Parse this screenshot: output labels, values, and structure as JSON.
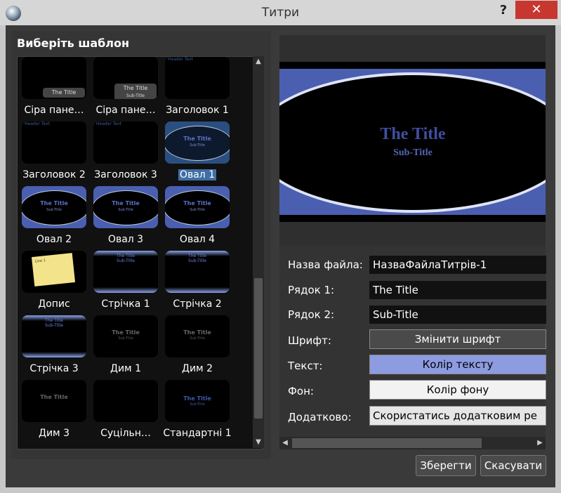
{
  "window": {
    "title": "Титри",
    "help": "?",
    "close": "✕"
  },
  "left": {
    "heading": "Виберіть шаблон"
  },
  "templates": [
    {
      "label": "Сіра пане…",
      "style": "panel",
      "thumb_text": "The Title"
    },
    {
      "label": "Сіра пане…",
      "style": "panel2",
      "thumb_text": "The Title",
      "thumb_sub": "Sub-Title"
    },
    {
      "label": "Заголовок 1",
      "style": "header",
      "thumb_text": "Header Text"
    },
    {
      "label": "Заголовок 2",
      "style": "header",
      "thumb_text": "Header Text"
    },
    {
      "label": "Заголовок 3",
      "style": "header",
      "thumb_text": "Header Text"
    },
    {
      "label": "Овал 1",
      "style": "oval-sel",
      "thumb_text": "The Title",
      "thumb_sub": "Sub-Title",
      "selected": true
    },
    {
      "label": "Овал 2",
      "style": "oval",
      "thumb_text": "The Title",
      "thumb_sub": "Sub-Title"
    },
    {
      "label": "Овал 3",
      "style": "oval",
      "thumb_text": "The Title",
      "thumb_sub": "Sub-Title"
    },
    {
      "label": "Овал 4",
      "style": "oval",
      "thumb_text": "The Title",
      "thumb_sub": "Sub-Title"
    },
    {
      "label": "Допис",
      "style": "note",
      "thumb_text": "Line 1"
    },
    {
      "label": "Стрічка 1",
      "style": "ribbon",
      "thumb_text": "The Title",
      "thumb_sub": "Sub-Title"
    },
    {
      "label": "Стрічка 2",
      "style": "ribbon",
      "thumb_text": "The Title",
      "thumb_sub": "Sub-Title"
    },
    {
      "label": "Стрічка 3",
      "style": "ribbon3",
      "thumb_text": "The Title",
      "thumb_sub": "Sub-Title"
    },
    {
      "label": "Дим 1",
      "style": "smoke",
      "thumb_text": "The Title",
      "thumb_sub": "Sub-Title"
    },
    {
      "label": "Дим 2",
      "style": "smoke",
      "thumb_text": "The Title",
      "thumb_sub": "Sub-Title"
    },
    {
      "label": "Дим 3",
      "style": "smoke",
      "thumb_text": "The Title"
    },
    {
      "label": "Суцільн…",
      "style": "plain",
      "thumb_text": ""
    },
    {
      "label": "Стандартні 1",
      "style": "std",
      "thumb_text": "The Title",
      "thumb_sub": "Sub-Title"
    }
  ],
  "preview": {
    "title": "The Title",
    "subtitle": "Sub-Title"
  },
  "props": {
    "filename_label": "Назва файла:",
    "filename_value": "НазваФайлаТитрів-1",
    "line1_label": "Рядок 1:",
    "line1_value": "The Title",
    "line2_label": "Рядок 2:",
    "line2_value": "Sub-Title",
    "font_label": "Шрифт:",
    "font_button": "Змінити шрифт",
    "text_label": "Текст:",
    "text_button": "Колір тексту",
    "bg_label": "Фон:",
    "bg_button": "Колір фону",
    "advanced_label": "Додатково:",
    "advanced_button": "Скористатись додатковим ре"
  },
  "buttons": {
    "save": "Зберегти",
    "cancel": "Скасувати"
  },
  "colors": {
    "accent": "#3f6fa5",
    "oval_blue": "#4a5fb0",
    "text_color_btn": "#8d9be0",
    "bg_color_btn": "#f2f2f2"
  }
}
